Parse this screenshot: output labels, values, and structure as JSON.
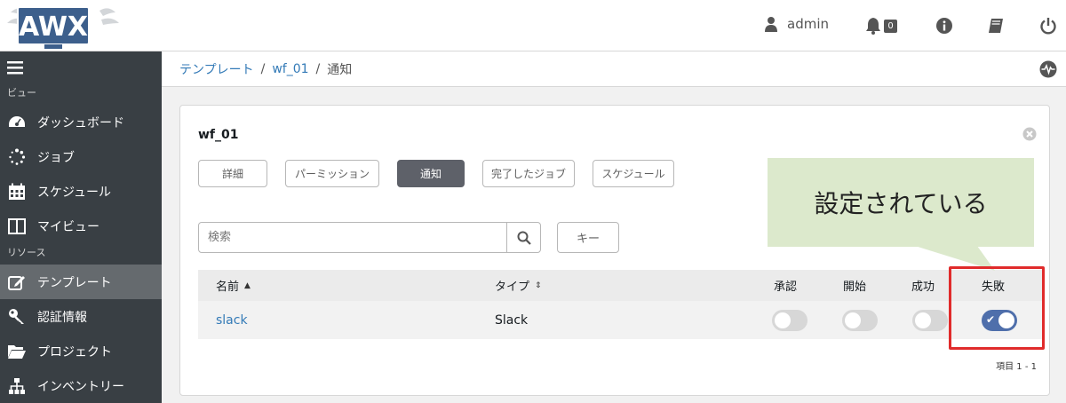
{
  "header": {
    "logo_text": "AWX",
    "user": "admin",
    "notification_count": "0",
    "icons": [
      "user-icon",
      "bell-icon",
      "info-icon",
      "book-icon",
      "power-icon"
    ]
  },
  "sidebar": {
    "sections": [
      {
        "label": "ビュー",
        "items": [
          {
            "label": "ダッシュボード",
            "icon": "dashboard-icon"
          },
          {
            "label": "ジョブ",
            "icon": "spinner-icon"
          },
          {
            "label": "スケジュール",
            "icon": "calendar-icon"
          },
          {
            "label": "マイビュー",
            "icon": "columns-icon"
          }
        ]
      },
      {
        "label": "リソース",
        "items": [
          {
            "label": "テンプレート",
            "icon": "edit-icon",
            "active": true
          },
          {
            "label": "認証情報",
            "icon": "key-icon"
          },
          {
            "label": "プロジェクト",
            "icon": "folder-icon"
          },
          {
            "label": "インベントリー",
            "icon": "sitemap-icon"
          }
        ]
      }
    ]
  },
  "breadcrumb": [
    {
      "label": "テンプレート",
      "link": true
    },
    {
      "label": "wf_01",
      "link": true
    },
    {
      "label": "通知",
      "link": false
    }
  ],
  "card": {
    "title": "wf_01",
    "tabs": [
      {
        "label": "詳細",
        "active": false
      },
      {
        "label": "パーミッション",
        "active": false
      },
      {
        "label": "通知",
        "active": true
      },
      {
        "label": "完了したジョブ",
        "active": false
      },
      {
        "label": "スケジュール",
        "active": false
      }
    ],
    "search_placeholder": "検索",
    "key_button": "キー",
    "table": {
      "columns": [
        "名前",
        "タイプ",
        "承認",
        "開始",
        "成功",
        "失敗"
      ],
      "rows": [
        {
          "name": "slack",
          "type": "Slack",
          "approval": false,
          "start": false,
          "success": false,
          "failure": true
        }
      ]
    },
    "count": "項目 1 - 1"
  },
  "annotation": {
    "text": "設定されている",
    "fill_color": "#dce9cc",
    "highlight_color": "#e02b2b"
  }
}
